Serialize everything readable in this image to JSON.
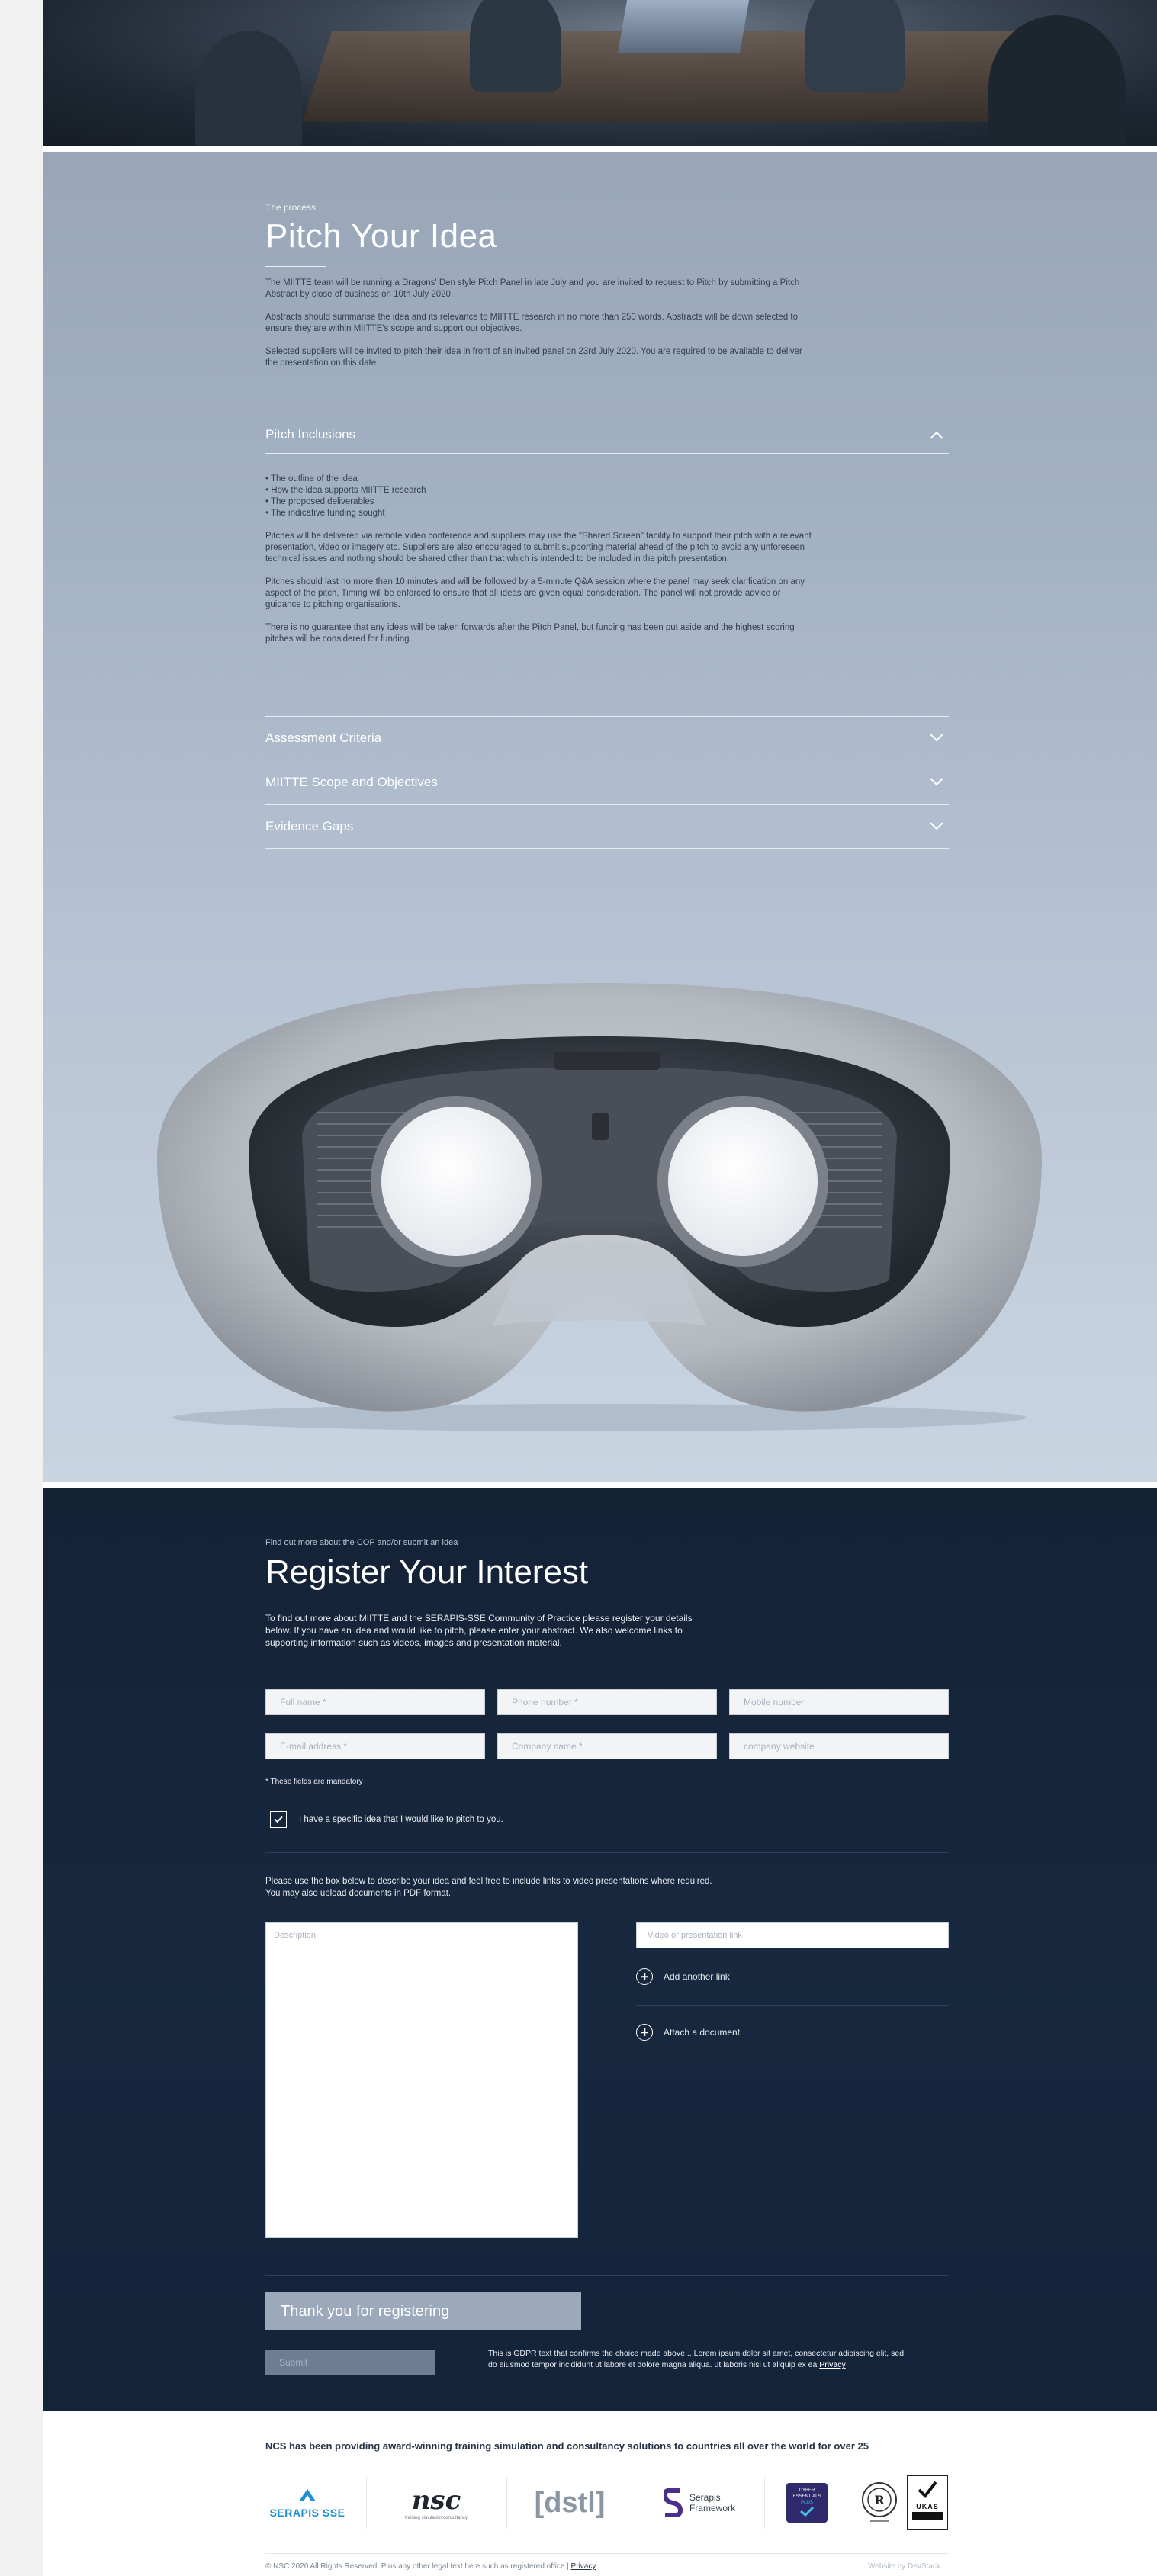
{
  "process": {
    "eyebrow": "The process",
    "title": "Pitch Your Idea",
    "paragraphs": [
      "The MIITTE team will be running a Dragons' Den style Pitch Panel in late July and you are invited to request to Pitch by submitting a Pitch Abstract by close of business on 10th July 2020.",
      "Abstracts should summarise the idea and its relevance to MIITTE research in no more than 250 words. Abstracts will be down selected to ensure they are within MIITTE's scope and support our objectives.",
      "Selected suppliers will be invited to pitch their idea in front of an invited panel on 23rd July 2020. You are required to be available to deliver the presentation on this date."
    ],
    "accordion": [
      {
        "label": "Pitch Inclusions",
        "expanded": true,
        "bullets": [
          "• The outline of the idea",
          "• How the idea supports MIITTE research",
          "• The proposed deliverables",
          "• The indicative funding sought"
        ],
        "paragraphs": [
          "Pitches will be delivered via remote video conference and suppliers may use the \"Shared Screen\" facility to support their pitch with a relevant presentation, video or imagery etc. Suppliers are also encouraged to submit supporting material ahead of the pitch to avoid any unforeseen technical issues and nothing should be shared other than that which is intended to be included in the pitch presentation.",
          "Pitches should last no more than 10 minutes and will be followed by a 5-minute Q&A session where the panel may seek clarification on any aspect of the pitch. Timing will be enforced to ensure that all ideas are given equal consideration. The panel will not provide advice or guidance to pitching organisations.",
          "There is no guarantee that any ideas will be taken forwards after the Pitch Panel, but funding has been put aside and the highest scoring pitches will be considered for funding."
        ]
      },
      {
        "label": "Assessment Criteria",
        "expanded": false
      },
      {
        "label": "MIITTE Scope and Objectives",
        "expanded": false
      },
      {
        "label": "Evidence Gaps",
        "expanded": false
      }
    ]
  },
  "register": {
    "eyebrow": "Find out more about the COP and/or submit an idea",
    "title": "Register Your Interest",
    "intro": [
      "To find out more about MIITTE and the SERAPIS-SSE Community of Practice please register your details",
      "below. If you have an idea and would like to pitch, please enter your abstract. We also welcome links to",
      "supporting information such as videos, images and presentation material."
    ],
    "fields": {
      "full_name": "Full name *",
      "phone": "Phone number *",
      "mobile": "Mobile number",
      "email": "E-mail address *",
      "company": "Company name *",
      "website": "company website"
    },
    "mandatory_note": "* These fields are mandatory",
    "checkbox_label": "I have a specific idea that I would like to pitch to you.",
    "checkbox_checked": true,
    "upload_text": [
      "Please use the box below to describe your idea and feel free to include links to video presentations where required.",
      "You may also upload documents in PDF format."
    ],
    "description_placeholder": "Description",
    "video_link_placeholder": "Video or presentation link",
    "add_link_label": "Add another link",
    "attach_label": "Attach a document",
    "thanks_label": "Thank you for registering",
    "submit_label": "Submit",
    "gdpr_line1": "This is GDPR text that confirms the choice made above... Lorem ipsum dolor sit amet, consectetur adipiscing elit, sed",
    "gdpr_line2": "do eiusmod tempor incididunt ut labore et dolore magna aliqua. ut laboris nisi ut aliquip ex ea",
    "gdpr_link": "Privacy"
  },
  "footer": {
    "tagline": "NCS has been providing award-winning training simulation and consultancy solutions to countries all over the world for over 25",
    "logos": {
      "serapis": "SERAPIS SSE",
      "nsc": "nsc",
      "nsc_sub": "training simulation consultancy",
      "dstl": "[dstl]",
      "framework_line1": "Serapis",
      "framework_line2": "Framework",
      "cyber_line1": "CYBER",
      "cyber_line2": "ESSENTIALS",
      "cyber_line3": "PLUS",
      "ukas": "UKAS"
    },
    "copyright": "© NSC 2020 All Rights Reserved. Plus any other legal text here such as registered office |",
    "privacy": "Privacy",
    "credit": "Website by DevStack"
  },
  "colors": {
    "process_bg": "#a4b2c5",
    "register_bg": "#16253a",
    "accent_serapis": "#1e8fd0",
    "accent_framework": "#4c2f8a"
  }
}
